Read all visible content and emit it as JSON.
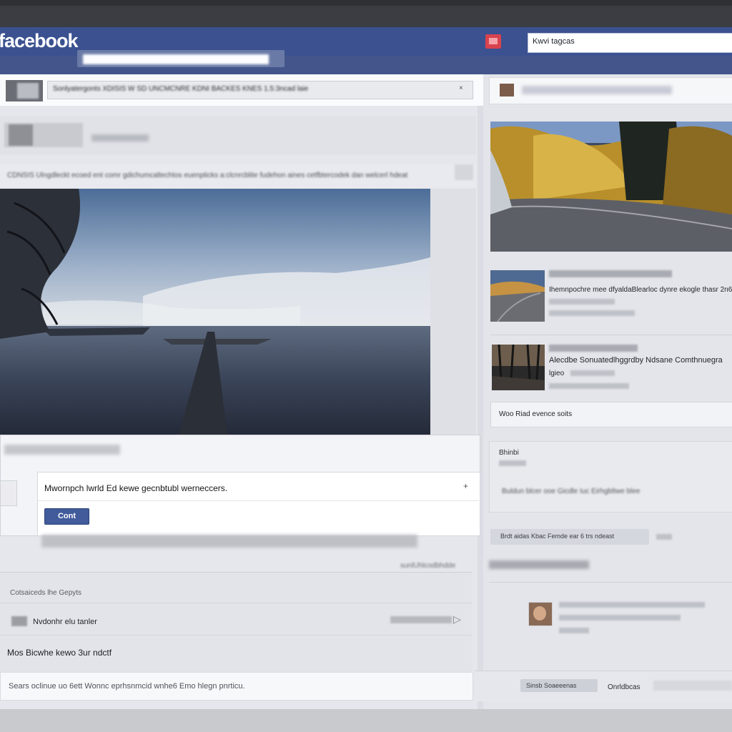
{
  "header": {
    "logo_text": "facebook",
    "search_value": "",
    "top_right_field_value": "Kwvi tagcas"
  },
  "composer": {
    "text": "Sonlyatergonts    XDISIS  W  SD UNCMCNRE KDNI  BACKES   KNES  1.5:3ncad  laie"
  },
  "post": {
    "caption": "CDNSIS  Ulngdleckt ecoed ent comr gdichumcaltechtos euenpticks a:clcnrcblite  fudehon aines cetfbtercodek dan welcerl hdeat",
    "photo_alt": "Lake with tree and wooden post"
  },
  "dialog": {
    "message": "Mwornpch lwrld Ed kewe gecnbtubl werneccers.",
    "close_glyph": "+",
    "button_label": "Cont"
  },
  "below_post": {
    "link_text": "sunlUhlcodbhdde",
    "comments_label": "Cotsaiceds lhe Gepyts",
    "comment_name": "Nvdonhr elu tanler",
    "comment_body": "Mos Bicwhe kewo 3ur ndctf",
    "footer_text": "Sears oclinue  uo 6ett Wonnc eprhsnmcid  wnhe6  Emo hlegn pnrticu."
  },
  "sidebar": {
    "card1_text": "Ihemnpochre mee dfyaldaBlearloc dynre ekogle  thasr 2n6",
    "card2_text": "Alecdbe  Sonuatedlhggrdby Ndsane  Comthnuegra",
    "card2_text2": "lgieo",
    "box_text": "Woo Riad evence soits",
    "panel_title": "Bhinbi",
    "panel_text": "Buldun blcer ooe Gicdle  Iuc Eirhgbltwe blee",
    "chip_text": "Brdt aidas  Kbac Femde  ear 6 trs ndeast",
    "bottom_pill_text": "Sinsb Soaeeenas  ",
    "bottom_text": "Onrldbcas"
  },
  "colors": {
    "facebook_blue": "#3b5190",
    "button_blue": "#415b9b",
    "notification_red": "#d9434e"
  }
}
